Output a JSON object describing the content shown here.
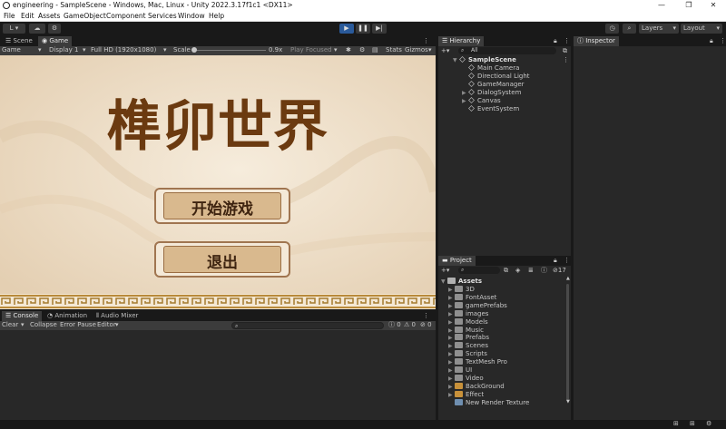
{
  "window": {
    "title": "engineering - SampleScene - Windows, Mac, Linux - Unity 2022.3.17f1c1 <DX11>",
    "minimize": "—",
    "maximize": "❐",
    "close": "✕"
  },
  "menu": [
    "File",
    "Edit",
    "Assets",
    "GameObject",
    "Component",
    "Services",
    "Window",
    "Help"
  ],
  "toolbar": {
    "account": "L ▾",
    "layers": "Layers",
    "layout": "Layout"
  },
  "scene_tabs": {
    "scene": "Scene",
    "game": "Game"
  },
  "game_toolbar": {
    "mode": "Game",
    "display": "Display 1",
    "resolution": "Full HD (1920x1080)",
    "scale_label": "Scale",
    "scale_value": "0.9x",
    "play_focused": "Play Focused",
    "stats": "Stats",
    "gizmos": "Gizmos"
  },
  "game": {
    "title": "榫卯世界",
    "start_button": "开始游戏",
    "exit_button": "退出"
  },
  "console": {
    "tabs": [
      "Console",
      "Animation",
      "Audio Mixer"
    ],
    "clear": "Clear",
    "collapse": "Collapse",
    "error_pause": "Error Pause",
    "editor": "Editor",
    "counts": [
      "0",
      "0",
      "0"
    ]
  },
  "hierarchy": {
    "tab": "Hierarchy",
    "search_placeholder": "All",
    "scene": "SampleScene",
    "items": [
      {
        "label": "Main Camera",
        "expandable": false
      },
      {
        "label": "Directional Light",
        "expandable": false
      },
      {
        "label": "GameManager",
        "expandable": false
      },
      {
        "label": "DialogSystem",
        "expandable": true
      },
      {
        "label": "Canvas",
        "expandable": true
      },
      {
        "label": "EventSystem",
        "expandable": false
      }
    ]
  },
  "inspector": {
    "tab": "Inspector"
  },
  "project": {
    "tab": "Project",
    "hidden_count": "17",
    "root": "Assets",
    "folders": [
      {
        "label": "3D",
        "type": "folder"
      },
      {
        "label": "FontAsset",
        "type": "folder"
      },
      {
        "label": "gamePrefabs",
        "type": "folder"
      },
      {
        "label": "images",
        "type": "folder"
      },
      {
        "label": "Models",
        "type": "folder"
      },
      {
        "label": "Music",
        "type": "folder"
      },
      {
        "label": "Prefabs",
        "type": "folder"
      },
      {
        "label": "Scenes",
        "type": "folder"
      },
      {
        "label": "Scripts",
        "type": "folder"
      },
      {
        "label": "TextMesh Pro",
        "type": "folder"
      },
      {
        "label": "UI",
        "type": "folder"
      },
      {
        "label": "Video",
        "type": "folder"
      },
      {
        "label": "BackGround",
        "type": "prefab"
      },
      {
        "label": "Effect",
        "type": "prefab"
      },
      {
        "label": "New Render Texture",
        "type": "texture"
      }
    ]
  },
  "colors": {
    "accent_blue": "#2a5a9a",
    "game_bg": "#f1e5d2",
    "title_brown": "#6b3a10"
  }
}
